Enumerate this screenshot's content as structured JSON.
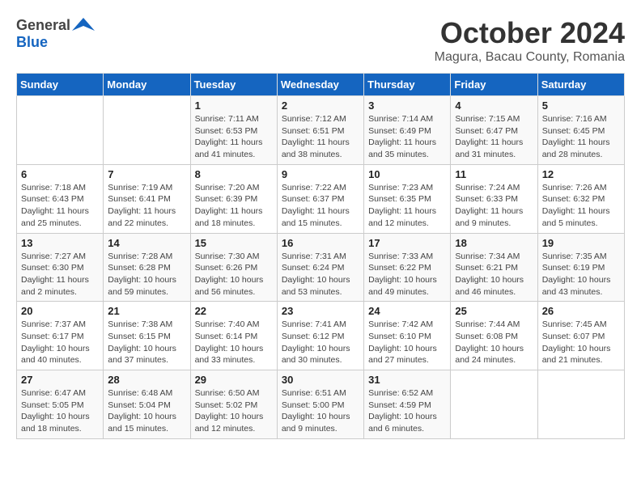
{
  "logo": {
    "general": "General",
    "blue": "Blue"
  },
  "title": "October 2024",
  "location": "Magura, Bacau County, Romania",
  "days_of_week": [
    "Sunday",
    "Monday",
    "Tuesday",
    "Wednesday",
    "Thursday",
    "Friday",
    "Saturday"
  ],
  "weeks": [
    [
      {
        "day": "",
        "info": ""
      },
      {
        "day": "",
        "info": ""
      },
      {
        "day": "1",
        "info": "Sunrise: 7:11 AM\nSunset: 6:53 PM\nDaylight: 11 hours and 41 minutes."
      },
      {
        "day": "2",
        "info": "Sunrise: 7:12 AM\nSunset: 6:51 PM\nDaylight: 11 hours and 38 minutes."
      },
      {
        "day": "3",
        "info": "Sunrise: 7:14 AM\nSunset: 6:49 PM\nDaylight: 11 hours and 35 minutes."
      },
      {
        "day": "4",
        "info": "Sunrise: 7:15 AM\nSunset: 6:47 PM\nDaylight: 11 hours and 31 minutes."
      },
      {
        "day": "5",
        "info": "Sunrise: 7:16 AM\nSunset: 6:45 PM\nDaylight: 11 hours and 28 minutes."
      }
    ],
    [
      {
        "day": "6",
        "info": "Sunrise: 7:18 AM\nSunset: 6:43 PM\nDaylight: 11 hours and 25 minutes."
      },
      {
        "day": "7",
        "info": "Sunrise: 7:19 AM\nSunset: 6:41 PM\nDaylight: 11 hours and 22 minutes."
      },
      {
        "day": "8",
        "info": "Sunrise: 7:20 AM\nSunset: 6:39 PM\nDaylight: 11 hours and 18 minutes."
      },
      {
        "day": "9",
        "info": "Sunrise: 7:22 AM\nSunset: 6:37 PM\nDaylight: 11 hours and 15 minutes."
      },
      {
        "day": "10",
        "info": "Sunrise: 7:23 AM\nSunset: 6:35 PM\nDaylight: 11 hours and 12 minutes."
      },
      {
        "day": "11",
        "info": "Sunrise: 7:24 AM\nSunset: 6:33 PM\nDaylight: 11 hours and 9 minutes."
      },
      {
        "day": "12",
        "info": "Sunrise: 7:26 AM\nSunset: 6:32 PM\nDaylight: 11 hours and 5 minutes."
      }
    ],
    [
      {
        "day": "13",
        "info": "Sunrise: 7:27 AM\nSunset: 6:30 PM\nDaylight: 11 hours and 2 minutes."
      },
      {
        "day": "14",
        "info": "Sunrise: 7:28 AM\nSunset: 6:28 PM\nDaylight: 10 hours and 59 minutes."
      },
      {
        "day": "15",
        "info": "Sunrise: 7:30 AM\nSunset: 6:26 PM\nDaylight: 10 hours and 56 minutes."
      },
      {
        "day": "16",
        "info": "Sunrise: 7:31 AM\nSunset: 6:24 PM\nDaylight: 10 hours and 53 minutes."
      },
      {
        "day": "17",
        "info": "Sunrise: 7:33 AM\nSunset: 6:22 PM\nDaylight: 10 hours and 49 minutes."
      },
      {
        "day": "18",
        "info": "Sunrise: 7:34 AM\nSunset: 6:21 PM\nDaylight: 10 hours and 46 minutes."
      },
      {
        "day": "19",
        "info": "Sunrise: 7:35 AM\nSunset: 6:19 PM\nDaylight: 10 hours and 43 minutes."
      }
    ],
    [
      {
        "day": "20",
        "info": "Sunrise: 7:37 AM\nSunset: 6:17 PM\nDaylight: 10 hours and 40 minutes."
      },
      {
        "day": "21",
        "info": "Sunrise: 7:38 AM\nSunset: 6:15 PM\nDaylight: 10 hours and 37 minutes."
      },
      {
        "day": "22",
        "info": "Sunrise: 7:40 AM\nSunset: 6:14 PM\nDaylight: 10 hours and 33 minutes."
      },
      {
        "day": "23",
        "info": "Sunrise: 7:41 AM\nSunset: 6:12 PM\nDaylight: 10 hours and 30 minutes."
      },
      {
        "day": "24",
        "info": "Sunrise: 7:42 AM\nSunset: 6:10 PM\nDaylight: 10 hours and 27 minutes."
      },
      {
        "day": "25",
        "info": "Sunrise: 7:44 AM\nSunset: 6:08 PM\nDaylight: 10 hours and 24 minutes."
      },
      {
        "day": "26",
        "info": "Sunrise: 7:45 AM\nSunset: 6:07 PM\nDaylight: 10 hours and 21 minutes."
      }
    ],
    [
      {
        "day": "27",
        "info": "Sunrise: 6:47 AM\nSunset: 5:05 PM\nDaylight: 10 hours and 18 minutes."
      },
      {
        "day": "28",
        "info": "Sunrise: 6:48 AM\nSunset: 5:04 PM\nDaylight: 10 hours and 15 minutes."
      },
      {
        "day": "29",
        "info": "Sunrise: 6:50 AM\nSunset: 5:02 PM\nDaylight: 10 hours and 12 minutes."
      },
      {
        "day": "30",
        "info": "Sunrise: 6:51 AM\nSunset: 5:00 PM\nDaylight: 10 hours and 9 minutes."
      },
      {
        "day": "31",
        "info": "Sunrise: 6:52 AM\nSunset: 4:59 PM\nDaylight: 10 hours and 6 minutes."
      },
      {
        "day": "",
        "info": ""
      },
      {
        "day": "",
        "info": ""
      }
    ]
  ]
}
